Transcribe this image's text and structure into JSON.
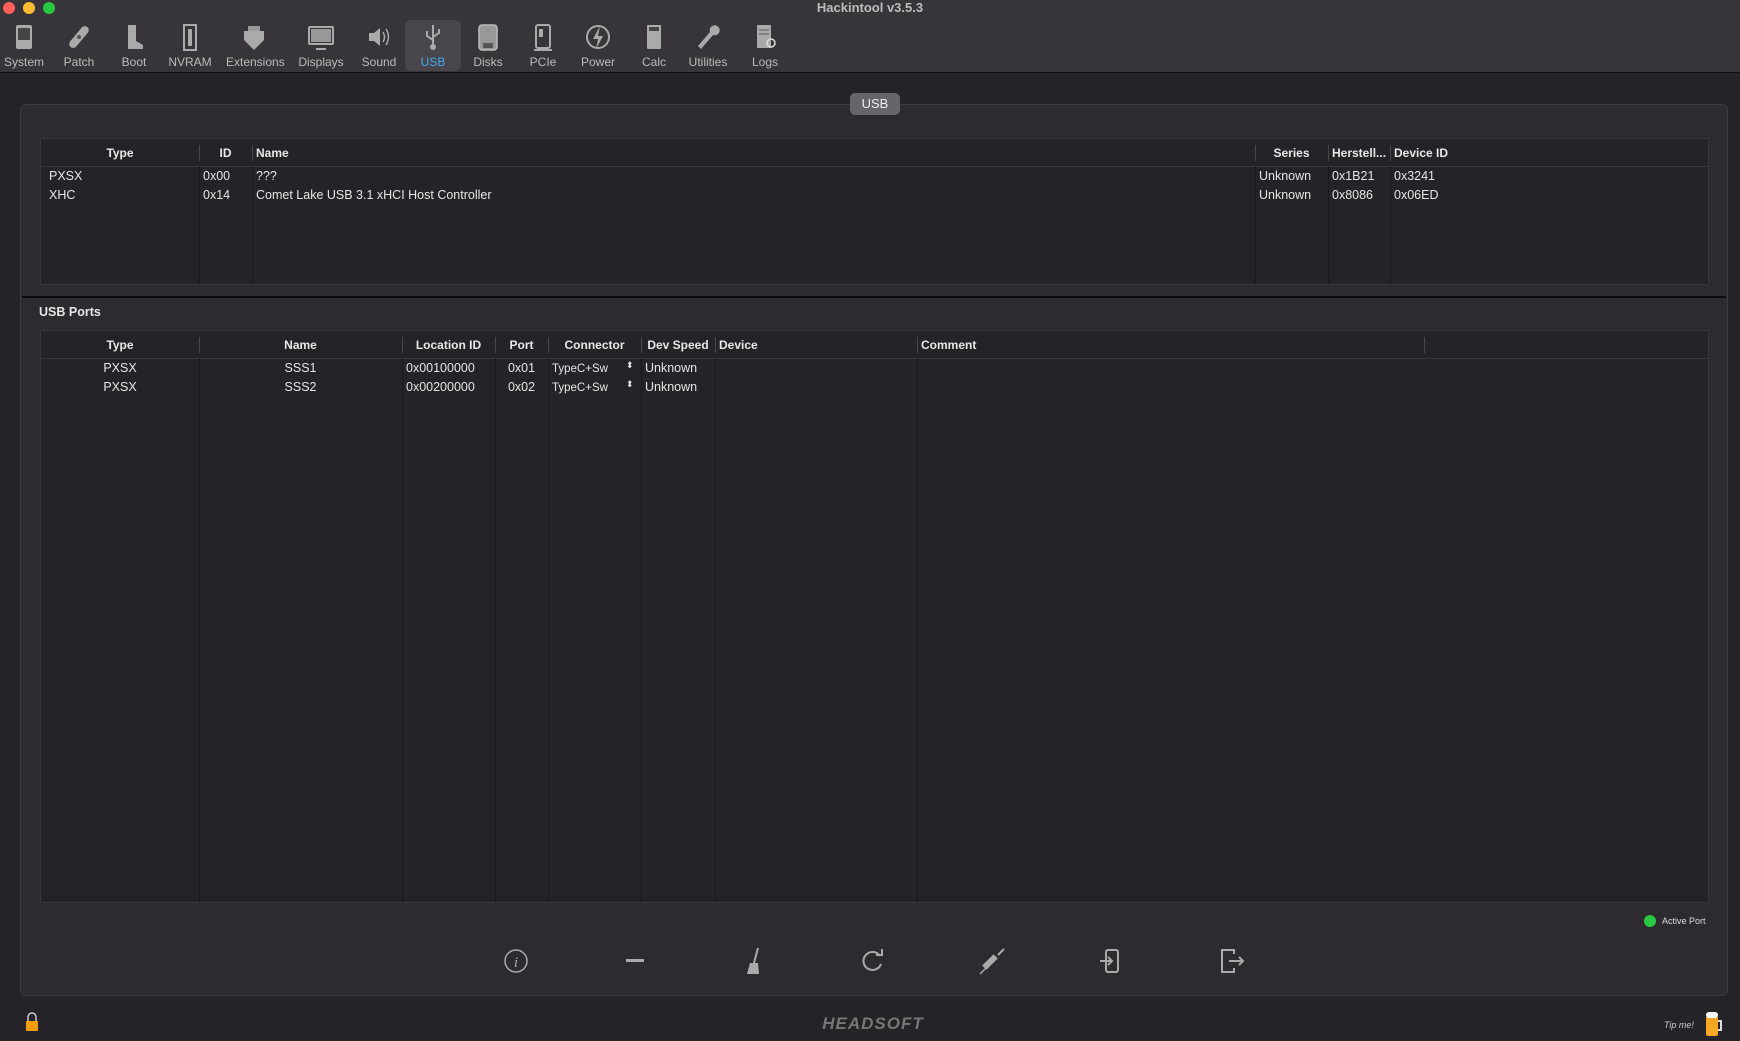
{
  "window": {
    "title": "Hackintool v3.5.3"
  },
  "toolbar": [
    {
      "label": "System",
      "icon": "computer-icon"
    },
    {
      "label": "Patch",
      "icon": "bandage-icon"
    },
    {
      "label": "Boot",
      "icon": "boot-icon"
    },
    {
      "label": "NVRAM",
      "icon": "memory-icon"
    },
    {
      "label": "Extensions",
      "icon": "lego-icon"
    },
    {
      "label": "Displays",
      "icon": "monitor-icon"
    },
    {
      "label": "Sound",
      "icon": "speaker-icon"
    },
    {
      "label": "USB",
      "icon": "usb-icon",
      "active": true
    },
    {
      "label": "Disks",
      "icon": "disk-icon"
    },
    {
      "label": "PCIe",
      "icon": "pcie-icon"
    },
    {
      "label": "Power",
      "icon": "power-icon"
    },
    {
      "label": "Calc",
      "icon": "calculator-icon"
    },
    {
      "label": "Utilities",
      "icon": "wrench-icon"
    },
    {
      "label": "Logs",
      "icon": "logs-icon"
    }
  ],
  "panel_tab": "USB",
  "controllers": {
    "headers": [
      "Type",
      "ID",
      "Name",
      "Series",
      "Herstell...",
      "Device ID"
    ],
    "rows": [
      [
        "PXSX",
        "0x00",
        "???",
        "Unknown",
        "0x1B21",
        "0x3241"
      ],
      [
        "XHC",
        "0x14",
        "Comet Lake USB 3.1 xHCI Host Controller",
        "Unknown",
        "0x8086",
        "0x06ED"
      ]
    ]
  },
  "ports": {
    "title": "USB Ports",
    "headers": [
      "Type",
      "Name",
      "Location ID",
      "Port",
      "Connector",
      "Dev Speed",
      "Device",
      "Comment"
    ],
    "rows": [
      [
        "PXSX",
        "SSS1",
        "0x00100000",
        "0x01",
        "TypeC+Sw",
        "Unknown",
        "",
        ""
      ],
      [
        "PXSX",
        "SSS2",
        "0x00200000",
        "0x02",
        "TypeC+Sw",
        "Unknown",
        "",
        ""
      ]
    ]
  },
  "legend": {
    "label": "Active Port",
    "color": "#28c840"
  },
  "footer": {
    "brand": "HEADSOFT",
    "tip": "Tip me!"
  }
}
